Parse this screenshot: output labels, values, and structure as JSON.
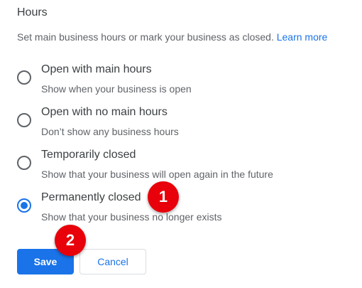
{
  "section": {
    "title": "Hours",
    "description": "Set main business hours or mark your business as closed.",
    "learn_more": "Learn more"
  },
  "options": [
    {
      "label": "Open with main hours",
      "description": "Show when your business is open",
      "checked": false
    },
    {
      "label": "Open with no main hours",
      "description": "Don’t show any business hours",
      "checked": false
    },
    {
      "label": "Temporarily closed",
      "description": "Show that your business will open again in the future",
      "checked": false
    },
    {
      "label": "Permanently closed",
      "description": "Show that your business no longer exists",
      "checked": true
    }
  ],
  "actions": {
    "save_label": "Save",
    "cancel_label": "Cancel"
  },
  "annotations": {
    "step1": "1",
    "step2": "2"
  },
  "colors": {
    "accent": "#1a73e8",
    "badge": "#e8000a"
  }
}
